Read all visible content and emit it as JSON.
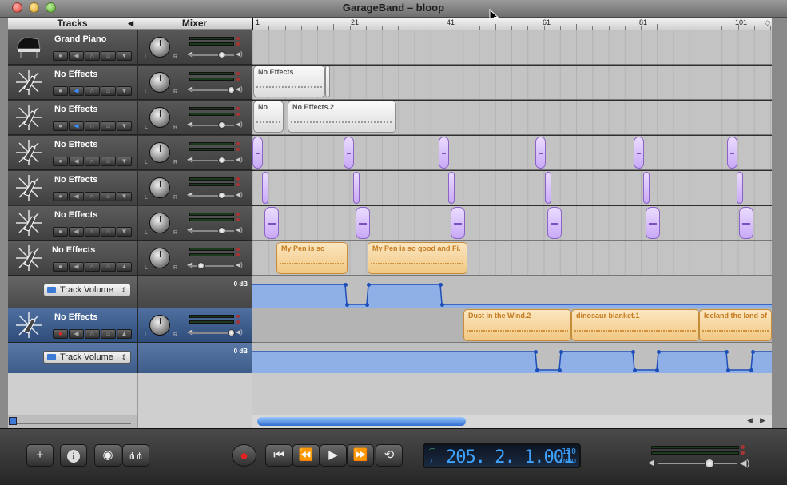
{
  "window": {
    "title": "GarageBand – bloop"
  },
  "headers": {
    "tracks": "Tracks",
    "mixer": "Mixer"
  },
  "ruler": {
    "marks": [
      "1",
      "21",
      "41",
      "61",
      "81",
      "101"
    ]
  },
  "tracks": [
    {
      "name": "Grand Piano",
      "icon": "grand-piano-icon"
    },
    {
      "name": "No Effects",
      "icon": "guitar-starburst-icon"
    },
    {
      "name": "No Effects",
      "icon": "guitar-starburst-icon"
    },
    {
      "name": "No Effects",
      "icon": "guitar-starburst-icon"
    },
    {
      "name": "No Effects",
      "icon": "guitar-starburst-icon"
    },
    {
      "name": "No Effects",
      "icon": "guitar-starburst-icon"
    },
    {
      "name": "No Effects",
      "icon": "guitar-starburst-icon"
    },
    {
      "name": "No Effects",
      "icon": "guitar-starburst-icon"
    }
  ],
  "automation": {
    "label": "Track Volume",
    "db_label": "0 dB"
  },
  "regions": {
    "t2a": "No Effects",
    "t3a": "No",
    "t3b": "No Effects.2",
    "t7a": "My Pen is so",
    "t7b": "My Pen is so good and Fi.",
    "t8a": "Dust in the Wind.2",
    "t8b": "dinosaur blanket.1",
    "t8c": "Iceland the land of"
  },
  "controls": {
    "add": "+",
    "info": "i",
    "eye": "◉",
    "record": "●",
    "to_start": "⏮",
    "rewind": "⏪",
    "play": "▶",
    "forward": "⏩",
    "cycle": "⟲"
  },
  "lcd": {
    "position": "205. 2. 1.001",
    "tempo": "120",
    "tempo_label": "TEMPO"
  },
  "labels": {
    "l": "L",
    "r": "R"
  },
  "colors": {
    "accent": "#3ea2ff",
    "region_audio": "#f1c883",
    "region_midi": "#c9a9f7"
  }
}
